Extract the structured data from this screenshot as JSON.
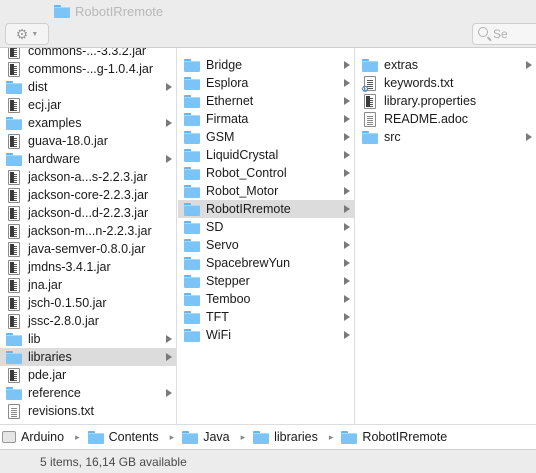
{
  "window": {
    "title": "RobotIRremote"
  },
  "toolbar": {
    "action_icon": "gear-icon",
    "search_placeholder": "Se"
  },
  "column1": {
    "items": [
      {
        "label": "commons-...-3.3.2.jar",
        "type": "jar"
      },
      {
        "label": "commons-...g-1.0.4.jar",
        "type": "jar"
      },
      {
        "label": "dist",
        "type": "folder"
      },
      {
        "label": "ecj.jar",
        "type": "jar"
      },
      {
        "label": "examples",
        "type": "folder"
      },
      {
        "label": "guava-18.0.jar",
        "type": "jar"
      },
      {
        "label": "hardware",
        "type": "folder"
      },
      {
        "label": "jackson-a...s-2.2.3.jar",
        "type": "jar"
      },
      {
        "label": "jackson-core-2.2.3.jar",
        "type": "jar"
      },
      {
        "label": "jackson-d...d-2.2.3.jar",
        "type": "jar"
      },
      {
        "label": "jackson-m...n-2.2.3.jar",
        "type": "jar"
      },
      {
        "label": "java-semver-0.8.0.jar",
        "type": "jar"
      },
      {
        "label": "jmdns-3.4.1.jar",
        "type": "jar"
      },
      {
        "label": "jna.jar",
        "type": "jar"
      },
      {
        "label": "jsch-0.1.50.jar",
        "type": "jar"
      },
      {
        "label": "jssc-2.8.0.jar",
        "type": "jar"
      },
      {
        "label": "lib",
        "type": "folder"
      },
      {
        "label": "libraries",
        "type": "folder",
        "selected": true
      },
      {
        "label": "pde.jar",
        "type": "jar"
      },
      {
        "label": "reference",
        "type": "folder"
      },
      {
        "label": "revisions.txt",
        "type": "text"
      }
    ]
  },
  "column2": {
    "items": [
      {
        "label": "Bridge",
        "type": "folder"
      },
      {
        "label": "Esplora",
        "type": "folder"
      },
      {
        "label": "Ethernet",
        "type": "folder"
      },
      {
        "label": "Firmata",
        "type": "folder"
      },
      {
        "label": "GSM",
        "type": "folder"
      },
      {
        "label": "LiquidCrystal",
        "type": "folder"
      },
      {
        "label": "Robot_Control",
        "type": "folder"
      },
      {
        "label": "Robot_Motor",
        "type": "folder"
      },
      {
        "label": "RobotIRremote",
        "type": "folder",
        "selected": true
      },
      {
        "label": "SD",
        "type": "folder"
      },
      {
        "label": "Servo",
        "type": "folder"
      },
      {
        "label": "SpacebrewYun",
        "type": "folder"
      },
      {
        "label": "Stepper",
        "type": "folder"
      },
      {
        "label": "Temboo",
        "type": "folder"
      },
      {
        "label": "TFT",
        "type": "folder"
      },
      {
        "label": "WiFi",
        "type": "folder"
      }
    ]
  },
  "column3": {
    "items": [
      {
        "label": "extras",
        "type": "folder"
      },
      {
        "label": "keywords.txt",
        "type": "gear"
      },
      {
        "label": "library.properties",
        "type": "jar"
      },
      {
        "label": "README.adoc",
        "type": "text"
      },
      {
        "label": "src",
        "type": "folder"
      }
    ]
  },
  "pathbar": {
    "crumbs": [
      {
        "label": "Arduino",
        "type": "drive"
      },
      {
        "label": "Contents",
        "type": "folder"
      },
      {
        "label": "Java",
        "type": "folder"
      },
      {
        "label": "libraries",
        "type": "folder"
      },
      {
        "label": "RobotIRremote",
        "type": "folder"
      }
    ]
  },
  "status": {
    "text": "5 items, 16,14 GB available"
  }
}
